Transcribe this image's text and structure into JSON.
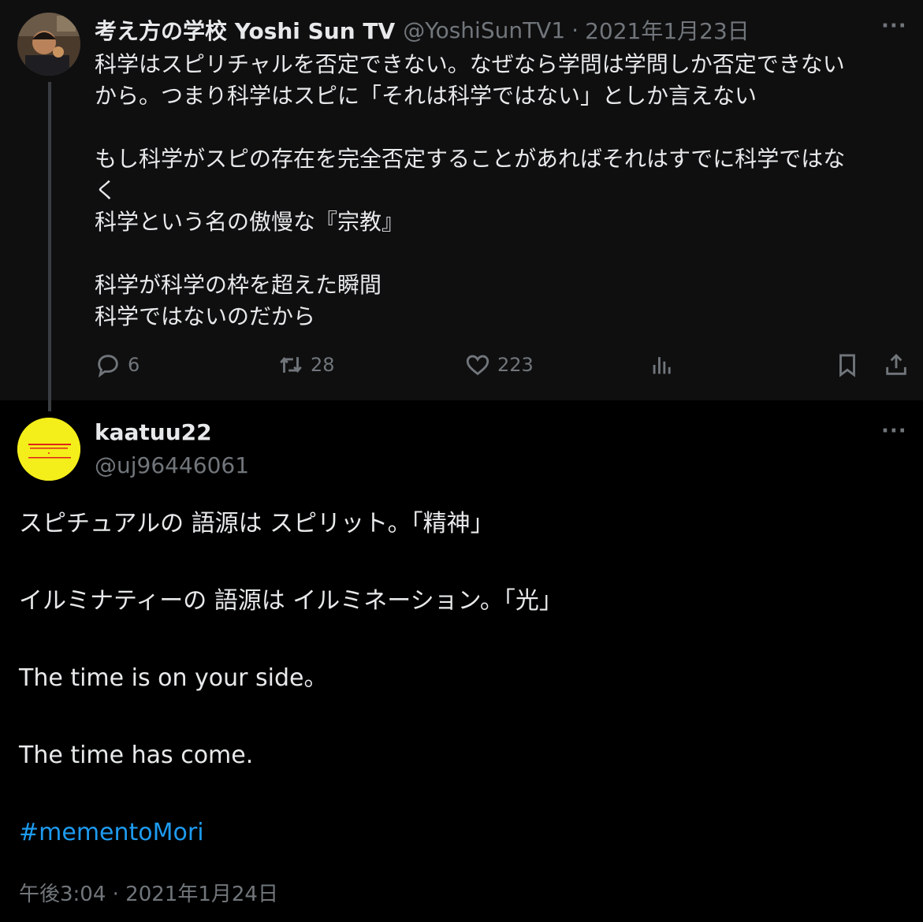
{
  "parent": {
    "name": "考え方の学校 Yoshi Sun TV",
    "handle": "@YoshiSunTV1",
    "separator": "·",
    "date": "2021年1月23日",
    "more_icon": "···",
    "lines": [
      "科学はスピリチャルを否定できない。なぜなら学問は学問しか否定できない",
      "から。つまり科学はスピに「それは科学ではない」としか言えない",
      "",
      "もし科学がスピの存在を完全否定することがあればそれはすでに科学ではな",
      "く",
      "科学という名の傲慢な『宗教』",
      "",
      "科学が科学の枠を超えた瞬間",
      "科学ではないのだから"
    ],
    "actions": {
      "reply_count": "6",
      "retweet_count": "28",
      "like_count": "223"
    }
  },
  "reply": {
    "name": "kaatuu22",
    "handle": "@uj96446061",
    "more_icon": "···",
    "lines": [
      "スピチュアルの 語源は スピリット。「精神」",
      "イルミナティーの 語源は イルミネーション。「光」",
      "The time is on your side。",
      "The time has come."
    ],
    "hashtag": "#mementoMori",
    "timestamp": "午後3:04 · 2021年1月24日"
  },
  "colors": {
    "background": "#000000",
    "parent_background": "#0f0f10",
    "text": "#e7e9ea",
    "muted": "#71767b",
    "link": "#1d9bf0",
    "reply_avatar": "#f4ee1a"
  }
}
